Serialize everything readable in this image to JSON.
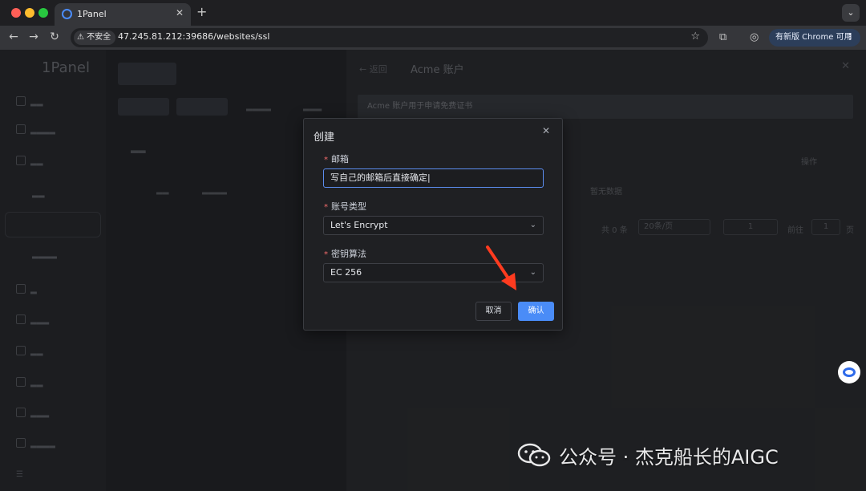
{
  "browser": {
    "tab_title": "1Panel",
    "tab_close": "✕",
    "new_tab": "+",
    "menu_icon": "⌄",
    "security_label": "不安全",
    "url": "47.245.81.212:39686/websites/ssl",
    "update_label": "有新版 Chrome 可用",
    "update_dots": "⋮"
  },
  "app": {
    "logo": "1Panel",
    "drawer": {
      "back": "←  返回",
      "title": "Acme 账户",
      "close": "✕",
      "note": "Acme 账户用于申请免费证书",
      "col_action": "操作",
      "empty": "暂无数据",
      "total": "共 0 条",
      "page_size": "20条/页",
      "page_number": "1",
      "goto_label": "前往",
      "goto_value": "1",
      "page_suffix": "页"
    }
  },
  "dialog": {
    "title": "创建",
    "close": "✕",
    "email_label": "邮箱",
    "email_value": "写自己的邮箱后直接确定",
    "account_type_label": "账号类型",
    "account_type_value": "Let's Encrypt",
    "key_algorithm_label": "密钥算法",
    "key_algorithm_value": "EC 256",
    "required_mark": "*",
    "cancel_label": "取消",
    "confirm_label": "确认"
  },
  "watermark": "公众号 · 杰克船长的AIGC",
  "colors": {
    "accent": "#4a8cf7",
    "annotation_arrow": "#ff3b1f",
    "required": "#f56c6c"
  }
}
